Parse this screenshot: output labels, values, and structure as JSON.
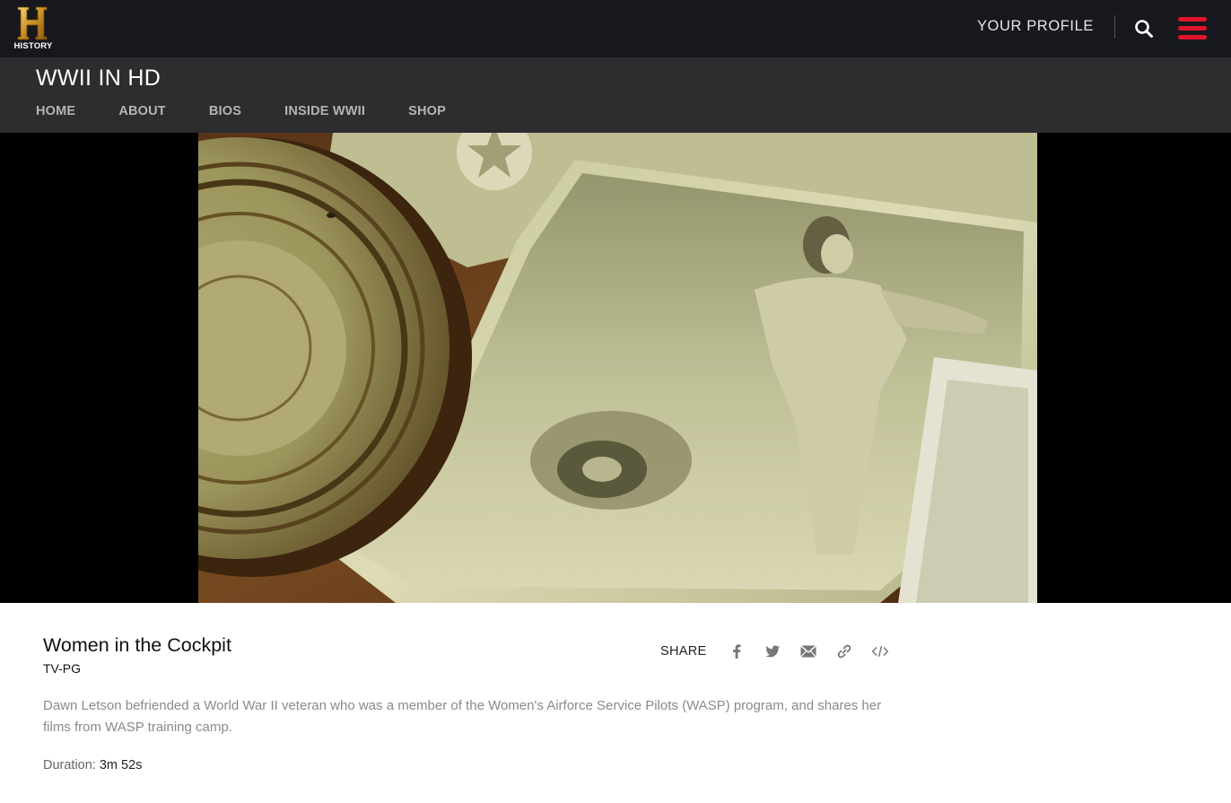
{
  "header": {
    "logo": {
      "letter": "H",
      "text": "HISTORY"
    },
    "profile_label": "YOUR PROFILE",
    "search_icon": "search-icon",
    "menu_icon": "hamburger-menu-icon",
    "menu_color": "#e0142b"
  },
  "show": {
    "title": "WWII IN HD",
    "nav": [
      "HOME",
      "ABOUT",
      "BIOS",
      "INSIDE WWII",
      "SHOP"
    ]
  },
  "video": {
    "title": "Women in the Cockpit",
    "rating": "TV-PG",
    "description": "Dawn Letson befriended a World War II veteran who was a member of the Women's Airforce Service Pilots (WASP) program, and shares her films from WASP training camp.",
    "duration_label": "Duration:",
    "duration_value": "3m 52s"
  },
  "share": {
    "label": "SHARE",
    "icons": [
      "facebook-icon",
      "twitter-icon",
      "email-icon",
      "link-icon",
      "embed-icon"
    ]
  }
}
